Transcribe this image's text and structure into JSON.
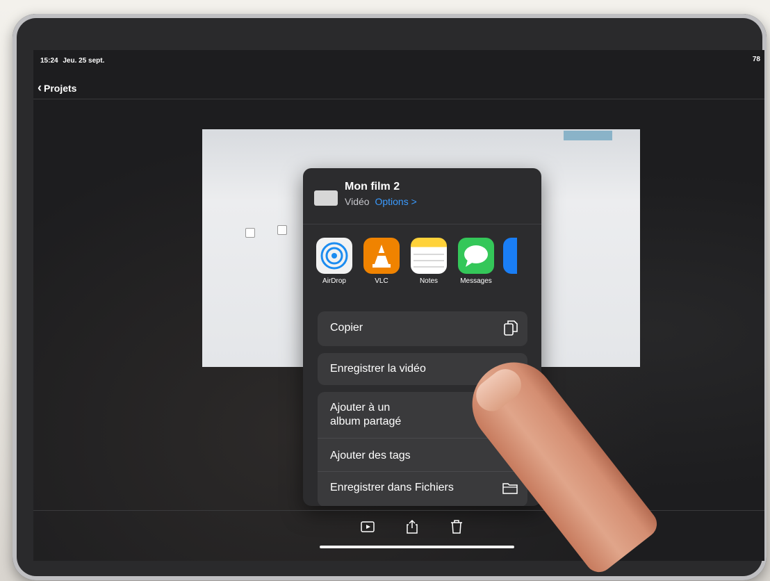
{
  "status": {
    "time": "15:24",
    "date": "Jeu. 25 sept.",
    "right": "78"
  },
  "nav": {
    "back_label": "Projets"
  },
  "share": {
    "title": "Mon film 2",
    "kind": "Vidéo",
    "options": "Options >",
    "apps": [
      {
        "label": "AirDrop",
        "icon": "airdrop-icon"
      },
      {
        "label": "VLC",
        "icon": "vlc-icon"
      },
      {
        "label": "Notes",
        "icon": "notes-icon"
      },
      {
        "label": "Messages",
        "icon": "messages-icon"
      }
    ],
    "actions": {
      "copy": "Copier",
      "save_video": "Enregistrer la vidéo",
      "add_shared_album_1": "Ajouter à un",
      "add_shared_album_2": "album partagé",
      "add_tags": "Ajouter des tags",
      "save_files": "Enregistrer dans Fichiers"
    }
  },
  "colors": {
    "accent": "#3a9bff",
    "sheet_bg": "#2c2c2e",
    "row_bg": "#3a3a3c"
  }
}
